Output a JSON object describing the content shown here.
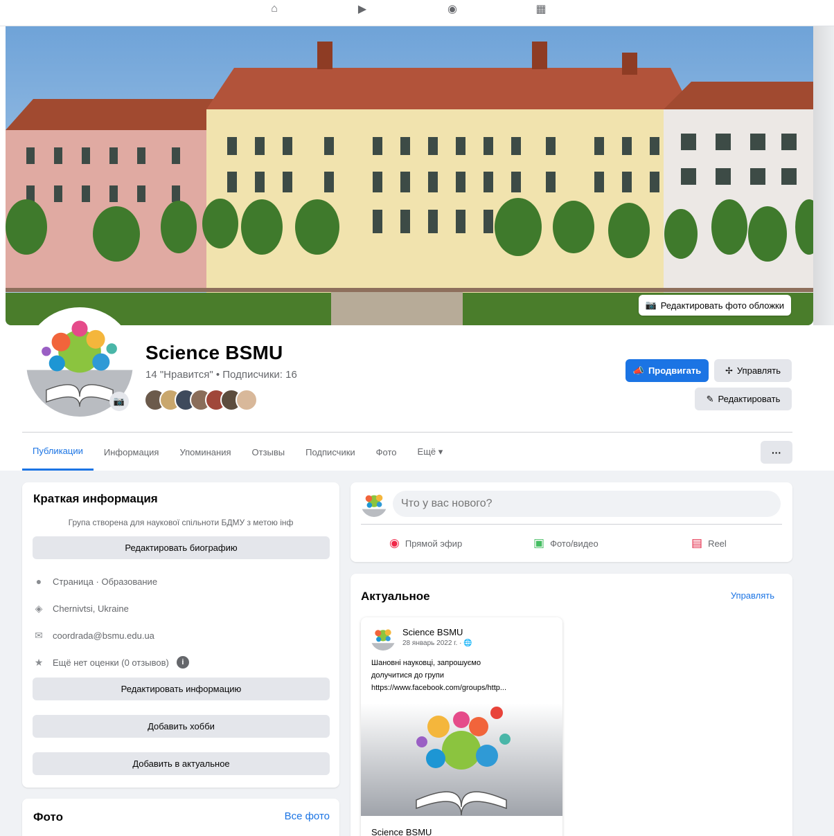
{
  "page": {
    "title": "Science BSMU",
    "stats": "14 \"Нравится\" • Подписчики: 16"
  },
  "cover": {
    "edit_label": "Редактировать фото обложки"
  },
  "actions": {
    "promote": "Продвигать",
    "manage": "Управлять",
    "edit": "Редактировать"
  },
  "tabs": [
    {
      "label": "Публикации",
      "active": true
    },
    {
      "label": "Информация"
    },
    {
      "label": "Упоминания"
    },
    {
      "label": "Отзывы"
    },
    {
      "label": "Подписчики"
    },
    {
      "label": "Фото"
    },
    {
      "label": "Ещё ▾"
    }
  ],
  "tabs_more_label": "···",
  "intro": {
    "title": "Краткая информация",
    "description": "Група створена для наукової спільноти БДМУ з метою інф",
    "edit_bio": "Редактировать биографию",
    "page_type": "Страница · Образование",
    "location": "Chernivtsi, Ukraine",
    "email": "coordrada@bsmu.edu.ua",
    "rating": "Ещё нет оценки (0 отзывов)",
    "edit_info": "Редактировать информацию",
    "add_hobby": "Добавить хобби",
    "add_featured": "Добавить в актуальное"
  },
  "photos": {
    "title": "Фото",
    "all_photos": "Все фото"
  },
  "composer": {
    "placeholder": "Что у вас нового?",
    "live": "Прямой эфир",
    "photo_video": "Фото/видео",
    "reel": "Reel"
  },
  "featured": {
    "title": "Актуальное",
    "manage": "Управлять",
    "post": {
      "author": "Science BSMU",
      "date": "28 январь 2022 г. · ",
      "body_line1": "Шановні науковці, запрошуємо",
      "body_line2": "долучитися до групи",
      "body_line3": "https://www.facebook.com/groups/http...",
      "footer_title": "Science BSMU"
    }
  },
  "colors": {
    "brand_blue": "#1b74e4",
    "button_gray": "#e4e6eb",
    "background": "#f0f2f5"
  }
}
